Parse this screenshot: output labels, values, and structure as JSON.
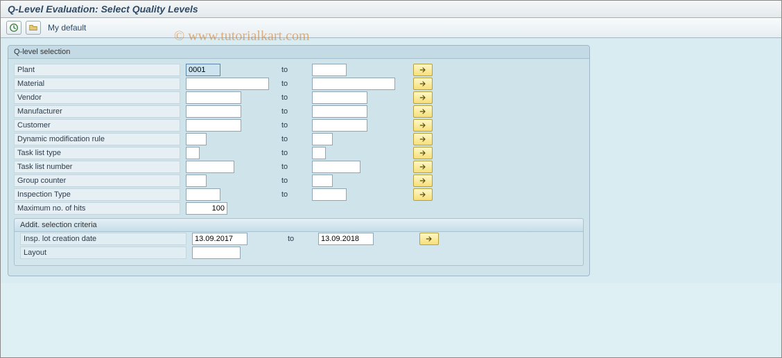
{
  "title": "Q-Level Evaluation: Select Quality Levels",
  "toolbar": {
    "my_default": "My default"
  },
  "watermark": "© www.tutorialkart.com",
  "group": {
    "title": "Q-level selection",
    "to_label": "to",
    "rows": [
      {
        "label": "Plant",
        "from": "0001",
        "to": "",
        "fw": 50,
        "tw": 50,
        "sel": true,
        "more": true
      },
      {
        "label": "Material",
        "from": "",
        "to": "",
        "fw": 120,
        "tw": 120,
        "more": true
      },
      {
        "label": "Vendor",
        "from": "",
        "to": "",
        "fw": 80,
        "tw": 80,
        "more": true
      },
      {
        "label": "Manufacturer",
        "from": "",
        "to": "",
        "fw": 80,
        "tw": 80,
        "more": true
      },
      {
        "label": "Customer",
        "from": "",
        "to": "",
        "fw": 80,
        "tw": 80,
        "more": true
      },
      {
        "label": "Dynamic modification rule",
        "from": "",
        "to": "",
        "fw": 30,
        "tw": 30,
        "more": true
      },
      {
        "label": "Task list type",
        "from": "",
        "to": "",
        "fw": 20,
        "tw": 20,
        "more": true
      },
      {
        "label": "Task list number",
        "from": "",
        "to": "",
        "fw": 70,
        "tw": 70,
        "more": true
      },
      {
        "label": "Group counter",
        "from": "",
        "to": "",
        "fw": 30,
        "tw": 30,
        "more": true
      },
      {
        "label": "Inspection Type",
        "from": "",
        "to": "",
        "fw": 50,
        "tw": 50,
        "more": true
      },
      {
        "label": "Maximum no. of hits",
        "from": "100",
        "fw": 60,
        "single": true,
        "align": "right"
      }
    ],
    "sub": {
      "title": "Addit. selection criteria",
      "rows": [
        {
          "label": "Insp. lot creation date",
          "from": "13.09.2017",
          "to": "13.09.2018",
          "fw": 80,
          "tw": 80,
          "more": true
        },
        {
          "label": "Layout",
          "from": "",
          "fw": 70,
          "single": true
        }
      ]
    }
  }
}
